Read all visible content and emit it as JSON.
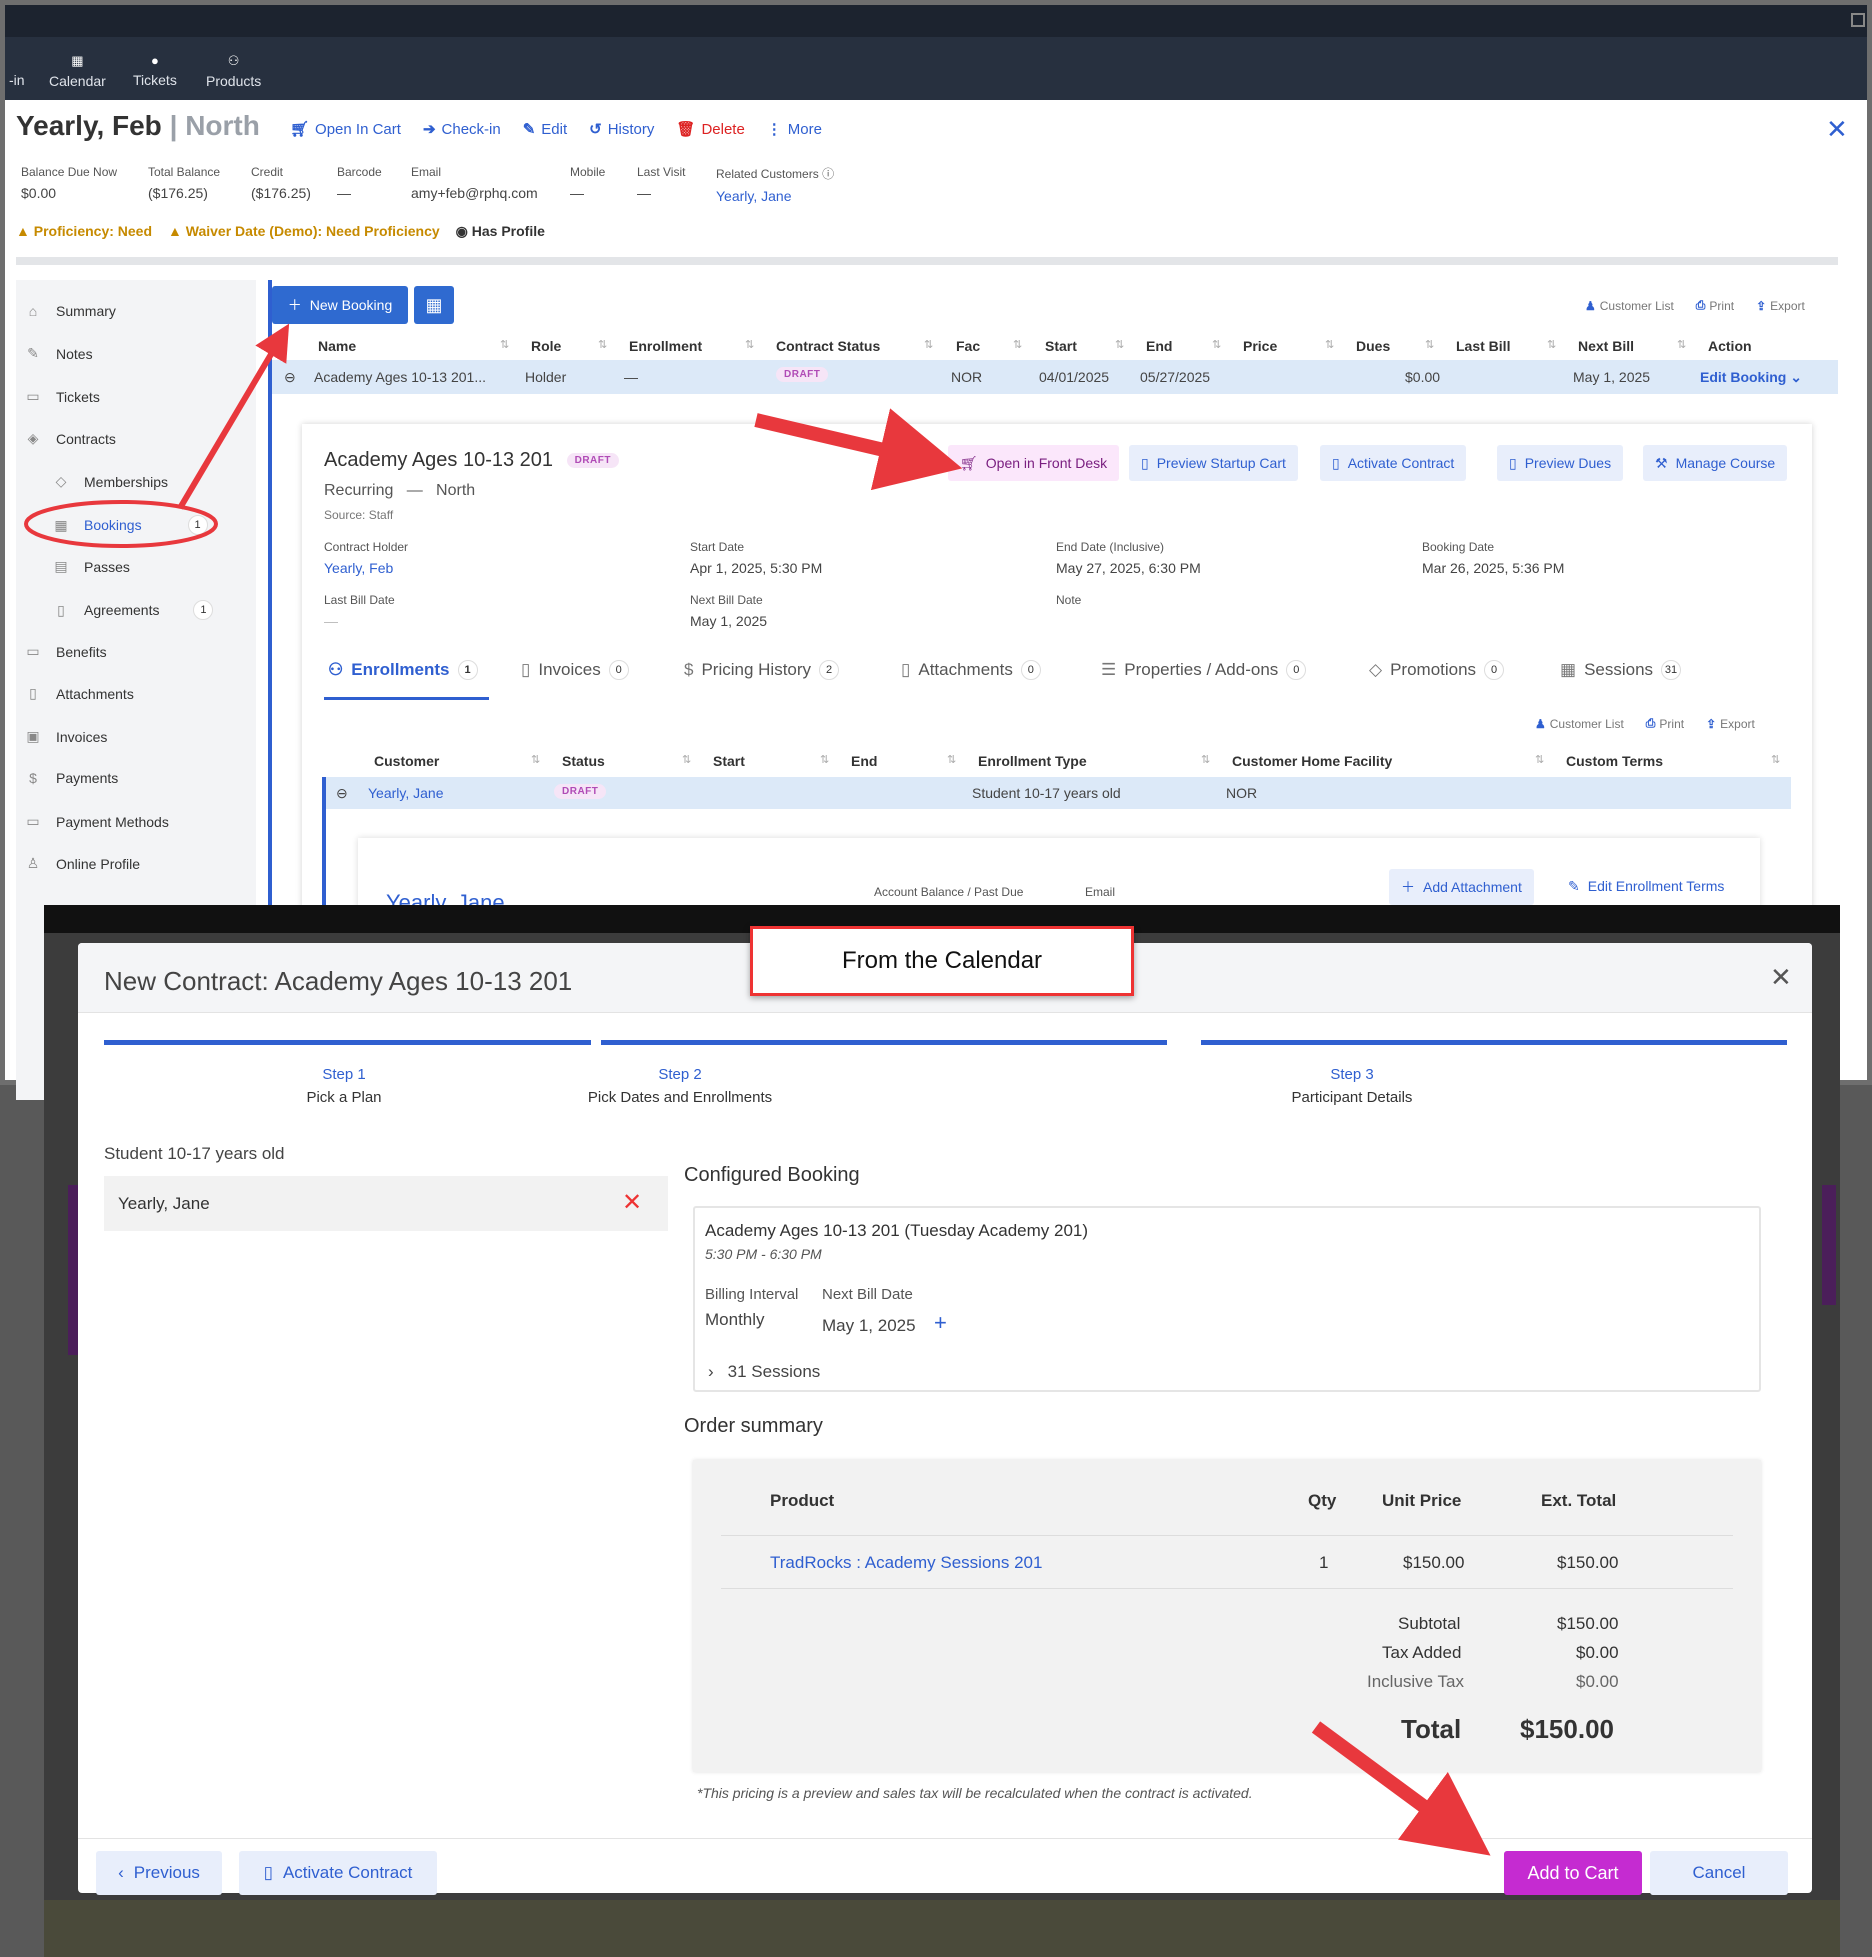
{
  "nav": {
    "cut_label": "-in",
    "items": [
      {
        "label": "Calendar",
        "icon": "calendar-icon"
      },
      {
        "label": "Tickets",
        "icon": "ticket-icon"
      },
      {
        "label": "Products",
        "icon": "products-icon"
      }
    ]
  },
  "customer": {
    "name": "Yearly, Feb",
    "separator": "|",
    "location": "North"
  },
  "actions": {
    "open_in_cart": "Open In Cart",
    "check_in": "Check-in",
    "edit": "Edit",
    "history": "History",
    "delete": "Delete",
    "more": "More"
  },
  "info": [
    {
      "label": "Balance Due Now",
      "value": "$0.00"
    },
    {
      "label": "Total Balance",
      "value": "($176.25)"
    },
    {
      "label": "Credit",
      "value": "($176.25)"
    },
    {
      "label": "Barcode",
      "value": "—"
    },
    {
      "label": "Email",
      "value": "amy+feb@rphq.com"
    },
    {
      "label": "Mobile",
      "value": "—"
    },
    {
      "label": "Last Visit",
      "value": "—"
    },
    {
      "label": "Related Customers",
      "value": "Yearly, Jane"
    }
  ],
  "alerts": {
    "proficiency": "Proficiency: Need",
    "waiver": "Waiver Date (Demo): Need Proficiency",
    "profile": "Has Profile"
  },
  "sidebar": [
    {
      "label": "Summary"
    },
    {
      "label": "Notes"
    },
    {
      "label": "Tickets"
    },
    {
      "label": "Contracts"
    },
    {
      "label": "Memberships"
    },
    {
      "label": "Bookings",
      "badge": "1"
    },
    {
      "label": "Passes"
    },
    {
      "label": "Agreements",
      "badge": "1"
    },
    {
      "label": "Benefits"
    },
    {
      "label": "Attachments"
    },
    {
      "label": "Invoices"
    },
    {
      "label": "Payments"
    },
    {
      "label": "Payment Methods"
    },
    {
      "label": "Online Profile"
    }
  ],
  "toolbar": {
    "new_booking": "New Booking",
    "customer_list": "Customer List",
    "print": "Print",
    "export": "Export"
  },
  "bookings_table": {
    "headers": [
      "Name",
      "Role",
      "Enrollment",
      "Contract Status",
      "Fac",
      "Start",
      "End",
      "Price",
      "Dues",
      "Last Bill",
      "Next Bill",
      "Action"
    ],
    "row": {
      "name": "Academy Ages 10-13 201...",
      "role": "Holder",
      "enrollment": "—",
      "status": "DRAFT",
      "fac": "NOR",
      "start": "04/01/2025",
      "end": "05/27/2025",
      "price": "",
      "dues": "$0.00",
      "last_bill": "",
      "next_bill": "May 1, 2025",
      "action": "Edit Booking"
    }
  },
  "booking_detail": {
    "title": "Academy Ages 10-13 201",
    "status": "DRAFT",
    "type": "Recurring",
    "dash": "—",
    "location": "North",
    "source": "Source: Staff",
    "buttons": {
      "front_desk": "Open in Front Desk",
      "preview_cart": "Preview Startup Cart",
      "activate": "Activate Contract",
      "preview_dues": "Preview Dues",
      "manage": "Manage Course"
    },
    "fields": [
      {
        "label": "Contract Holder",
        "value": "Yearly, Feb"
      },
      {
        "label": "Start Date",
        "value": "Apr 1, 2025, 5:30 PM"
      },
      {
        "label": "End Date (Inclusive)",
        "value": "May 27, 2025, 6:30 PM"
      },
      {
        "label": "Booking Date",
        "value": "Mar 26, 2025, 5:36 PM"
      },
      {
        "label": "Last Bill Date",
        "value": "—"
      },
      {
        "label": "Next Bill Date",
        "value": "May 1, 2025"
      },
      {
        "label": "Note",
        "value": ""
      }
    ],
    "tabs": [
      {
        "label": "Enrollments",
        "count": "1"
      },
      {
        "label": "Invoices",
        "count": "0"
      },
      {
        "label": "Pricing History",
        "count": "2"
      },
      {
        "label": "Attachments",
        "count": "0"
      },
      {
        "label": "Properties / Add-ons",
        "count": "0"
      },
      {
        "label": "Promotions",
        "count": "0"
      },
      {
        "label": "Sessions",
        "count": "31"
      }
    ]
  },
  "enroll_table": {
    "headers": [
      "Customer",
      "Status",
      "Start",
      "End",
      "Enrollment Type",
      "Customer Home Facility",
      "Custom Terms"
    ],
    "row": {
      "customer": "Yearly, Jane",
      "status": "DRAFT",
      "type": "Student 10-17 years old",
      "facility": "NOR"
    }
  },
  "enroll_card": {
    "name": "Yearly, Jane",
    "balance": "Account Balance / Past Due",
    "email": "Email",
    "add_attachment": "Add Attachment",
    "edit_terms": "Edit Enrollment Terms"
  },
  "callout": "From the Calendar",
  "modal": {
    "title": "New Contract: Academy Ages 10-13 201",
    "steps": [
      {
        "num": "Step 1",
        "label": "Pick a Plan"
      },
      {
        "num": "Step 2",
        "label": "Pick Dates and Enrollments"
      },
      {
        "num": "Step 3",
        "label": "Participant Details"
      }
    ],
    "plan_label": "Student 10-17 years old",
    "participant": "Yearly, Jane",
    "configured": "Configured Booking",
    "booking": {
      "title": "Academy Ages 10-13 201 (Tuesday Academy 201)",
      "time": "5:30 PM - 6:30 PM",
      "interval_label": "Billing Interval",
      "interval": "Monthly",
      "next_label": "Next Bill Date",
      "next": "May 1, 2025",
      "sessions": "31 Sessions"
    },
    "order_title": "Order summary",
    "order": {
      "headers": [
        "Product",
        "Qty",
        "Unit Price",
        "Ext. Total"
      ],
      "item": {
        "product": "TradRocks : Academy Sessions 201",
        "qty": "1",
        "unit": "$150.00",
        "total": "$150.00"
      },
      "subtotal_label": "Subtotal",
      "subtotal": "$150.00",
      "tax_label": "Tax Added",
      "tax": "$0.00",
      "incl_label": "Inclusive Tax",
      "incl": "$0.00",
      "total_label": "Total",
      "total": "$150.00"
    },
    "note": "*This pricing is a preview and sales tax will be recalculated when the contract is activated.",
    "buttons": {
      "previous": "Previous",
      "activate": "Activate Contract",
      "add_to_cart": "Add to Cart",
      "cancel": "Cancel"
    }
  },
  "colors": {
    "primary": "#2f5fd0",
    "add_to_cart": "#c52bd1",
    "arrow": "#e8383d",
    "warning": "#c68a00",
    "delete": "#dd2222"
  }
}
